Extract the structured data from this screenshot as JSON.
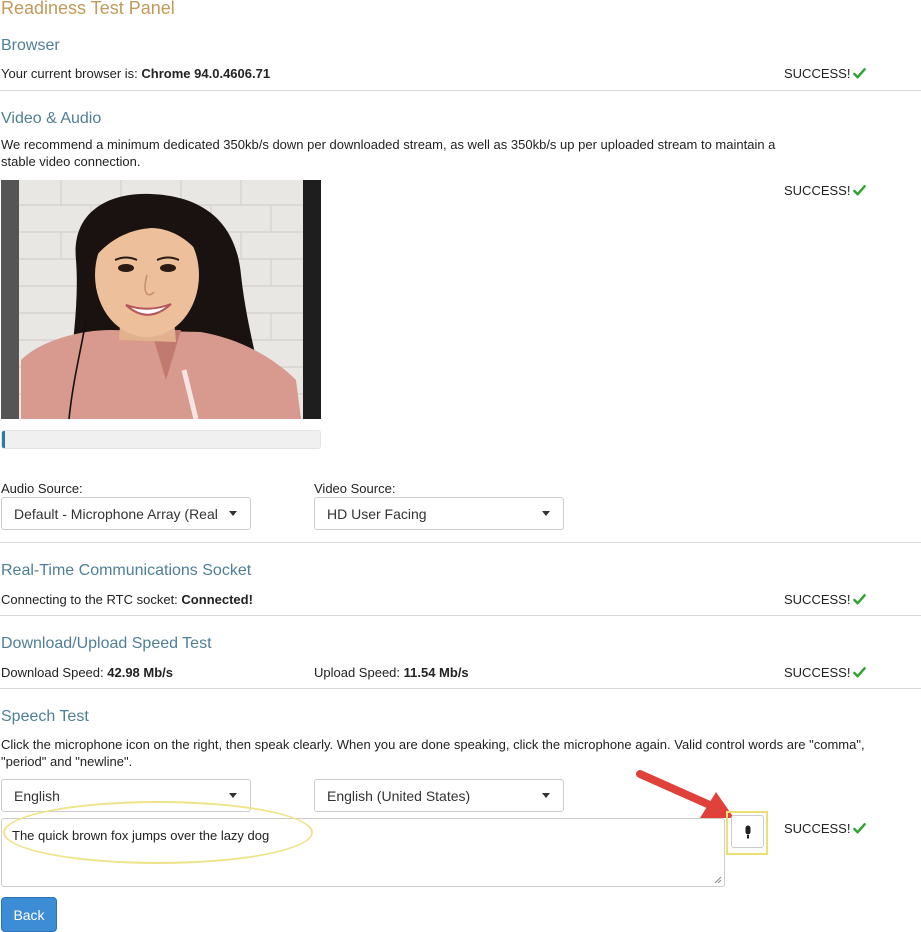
{
  "panel": {
    "title": "Readiness Test Panel"
  },
  "browser": {
    "title": "Browser",
    "label": "Your current browser is: ",
    "value": "Chrome 94.0.4606.71",
    "status": "SUCCESS!"
  },
  "video_audio": {
    "title": "Video & Audio",
    "description": "We recommend a minimum dedicated 350kb/s down per downloaded stream, as well as 350kb/s up per uploaded stream to maintain a stable video connection.",
    "status": "SUCCESS!",
    "audio_level_fraction": 0.01,
    "audio_source_label": "Audio Source:",
    "audio_source_value": "Default - Microphone Array (Real",
    "video_source_label": "Video Source:",
    "video_source_value": "HD User Facing"
  },
  "rtc": {
    "title": "Real-Time Communications Socket",
    "label": "Connecting to the RTC socket: ",
    "value": "Connected!",
    "status": "SUCCESS!"
  },
  "speed": {
    "title": "Download/Upload Speed Test",
    "download_label": "Download Speed: ",
    "download_value": "42.98 Mb/s",
    "upload_label": "Upload Speed: ",
    "upload_value": "11.54 Mb/s",
    "status": "SUCCESS!"
  },
  "speech": {
    "title": "Speech Test",
    "description": "Click the microphone icon on the right, then speak clearly. When you are done speaking, click the microphone again. Valid control words are \"comma\", \"period\" and \"newline\".",
    "language_value": "English",
    "dialect_value": "English (United States)",
    "transcript": "The quick brown fox jumps over the lazy dog",
    "status": "SUCCESS!"
  },
  "actions": {
    "back_label": "Back"
  },
  "icons": {
    "status": "check-icon",
    "mic": "microphone-icon"
  },
  "colors": {
    "success": "#2ea32e",
    "title": "#4f7f96",
    "panel_title": "#c29a5a",
    "primary_button": "#3d8cd6",
    "highlight": "#ece170",
    "arrow": "#e0413a"
  }
}
